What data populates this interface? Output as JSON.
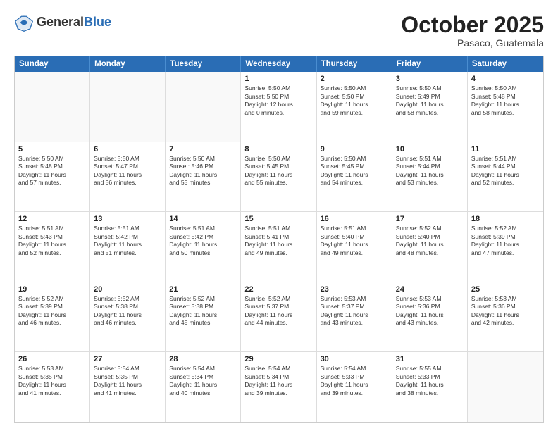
{
  "header": {
    "logo_general": "General",
    "logo_blue": "Blue",
    "month_title": "October 2025",
    "subtitle": "Pasaco, Guatemala"
  },
  "days_of_week": [
    "Sunday",
    "Monday",
    "Tuesday",
    "Wednesday",
    "Thursday",
    "Friday",
    "Saturday"
  ],
  "weeks": [
    [
      {
        "day": "",
        "lines": []
      },
      {
        "day": "",
        "lines": []
      },
      {
        "day": "",
        "lines": []
      },
      {
        "day": "1",
        "lines": [
          "Sunrise: 5:50 AM",
          "Sunset: 5:50 PM",
          "Daylight: 12 hours",
          "and 0 minutes."
        ]
      },
      {
        "day": "2",
        "lines": [
          "Sunrise: 5:50 AM",
          "Sunset: 5:50 PM",
          "Daylight: 11 hours",
          "and 59 minutes."
        ]
      },
      {
        "day": "3",
        "lines": [
          "Sunrise: 5:50 AM",
          "Sunset: 5:49 PM",
          "Daylight: 11 hours",
          "and 58 minutes."
        ]
      },
      {
        "day": "4",
        "lines": [
          "Sunrise: 5:50 AM",
          "Sunset: 5:48 PM",
          "Daylight: 11 hours",
          "and 58 minutes."
        ]
      }
    ],
    [
      {
        "day": "5",
        "lines": [
          "Sunrise: 5:50 AM",
          "Sunset: 5:48 PM",
          "Daylight: 11 hours",
          "and 57 minutes."
        ]
      },
      {
        "day": "6",
        "lines": [
          "Sunrise: 5:50 AM",
          "Sunset: 5:47 PM",
          "Daylight: 11 hours",
          "and 56 minutes."
        ]
      },
      {
        "day": "7",
        "lines": [
          "Sunrise: 5:50 AM",
          "Sunset: 5:46 PM",
          "Daylight: 11 hours",
          "and 55 minutes."
        ]
      },
      {
        "day": "8",
        "lines": [
          "Sunrise: 5:50 AM",
          "Sunset: 5:45 PM",
          "Daylight: 11 hours",
          "and 55 minutes."
        ]
      },
      {
        "day": "9",
        "lines": [
          "Sunrise: 5:50 AM",
          "Sunset: 5:45 PM",
          "Daylight: 11 hours",
          "and 54 minutes."
        ]
      },
      {
        "day": "10",
        "lines": [
          "Sunrise: 5:51 AM",
          "Sunset: 5:44 PM",
          "Daylight: 11 hours",
          "and 53 minutes."
        ]
      },
      {
        "day": "11",
        "lines": [
          "Sunrise: 5:51 AM",
          "Sunset: 5:44 PM",
          "Daylight: 11 hours",
          "and 52 minutes."
        ]
      }
    ],
    [
      {
        "day": "12",
        "lines": [
          "Sunrise: 5:51 AM",
          "Sunset: 5:43 PM",
          "Daylight: 11 hours",
          "and 52 minutes."
        ]
      },
      {
        "day": "13",
        "lines": [
          "Sunrise: 5:51 AM",
          "Sunset: 5:42 PM",
          "Daylight: 11 hours",
          "and 51 minutes."
        ]
      },
      {
        "day": "14",
        "lines": [
          "Sunrise: 5:51 AM",
          "Sunset: 5:42 PM",
          "Daylight: 11 hours",
          "and 50 minutes."
        ]
      },
      {
        "day": "15",
        "lines": [
          "Sunrise: 5:51 AM",
          "Sunset: 5:41 PM",
          "Daylight: 11 hours",
          "and 49 minutes."
        ]
      },
      {
        "day": "16",
        "lines": [
          "Sunrise: 5:51 AM",
          "Sunset: 5:40 PM",
          "Daylight: 11 hours",
          "and 49 minutes."
        ]
      },
      {
        "day": "17",
        "lines": [
          "Sunrise: 5:52 AM",
          "Sunset: 5:40 PM",
          "Daylight: 11 hours",
          "and 48 minutes."
        ]
      },
      {
        "day": "18",
        "lines": [
          "Sunrise: 5:52 AM",
          "Sunset: 5:39 PM",
          "Daylight: 11 hours",
          "and 47 minutes."
        ]
      }
    ],
    [
      {
        "day": "19",
        "lines": [
          "Sunrise: 5:52 AM",
          "Sunset: 5:39 PM",
          "Daylight: 11 hours",
          "and 46 minutes."
        ]
      },
      {
        "day": "20",
        "lines": [
          "Sunrise: 5:52 AM",
          "Sunset: 5:38 PM",
          "Daylight: 11 hours",
          "and 46 minutes."
        ]
      },
      {
        "day": "21",
        "lines": [
          "Sunrise: 5:52 AM",
          "Sunset: 5:38 PM",
          "Daylight: 11 hours",
          "and 45 minutes."
        ]
      },
      {
        "day": "22",
        "lines": [
          "Sunrise: 5:52 AM",
          "Sunset: 5:37 PM",
          "Daylight: 11 hours",
          "and 44 minutes."
        ]
      },
      {
        "day": "23",
        "lines": [
          "Sunrise: 5:53 AM",
          "Sunset: 5:37 PM",
          "Daylight: 11 hours",
          "and 43 minutes."
        ]
      },
      {
        "day": "24",
        "lines": [
          "Sunrise: 5:53 AM",
          "Sunset: 5:36 PM",
          "Daylight: 11 hours",
          "and 43 minutes."
        ]
      },
      {
        "day": "25",
        "lines": [
          "Sunrise: 5:53 AM",
          "Sunset: 5:36 PM",
          "Daylight: 11 hours",
          "and 42 minutes."
        ]
      }
    ],
    [
      {
        "day": "26",
        "lines": [
          "Sunrise: 5:53 AM",
          "Sunset: 5:35 PM",
          "Daylight: 11 hours",
          "and 41 minutes."
        ]
      },
      {
        "day": "27",
        "lines": [
          "Sunrise: 5:54 AM",
          "Sunset: 5:35 PM",
          "Daylight: 11 hours",
          "and 41 minutes."
        ]
      },
      {
        "day": "28",
        "lines": [
          "Sunrise: 5:54 AM",
          "Sunset: 5:34 PM",
          "Daylight: 11 hours",
          "and 40 minutes."
        ]
      },
      {
        "day": "29",
        "lines": [
          "Sunrise: 5:54 AM",
          "Sunset: 5:34 PM",
          "Daylight: 11 hours",
          "and 39 minutes."
        ]
      },
      {
        "day": "30",
        "lines": [
          "Sunrise: 5:54 AM",
          "Sunset: 5:33 PM",
          "Daylight: 11 hours",
          "and 39 minutes."
        ]
      },
      {
        "day": "31",
        "lines": [
          "Sunrise: 5:55 AM",
          "Sunset: 5:33 PM",
          "Daylight: 11 hours",
          "and 38 minutes."
        ]
      },
      {
        "day": "",
        "lines": []
      }
    ]
  ]
}
